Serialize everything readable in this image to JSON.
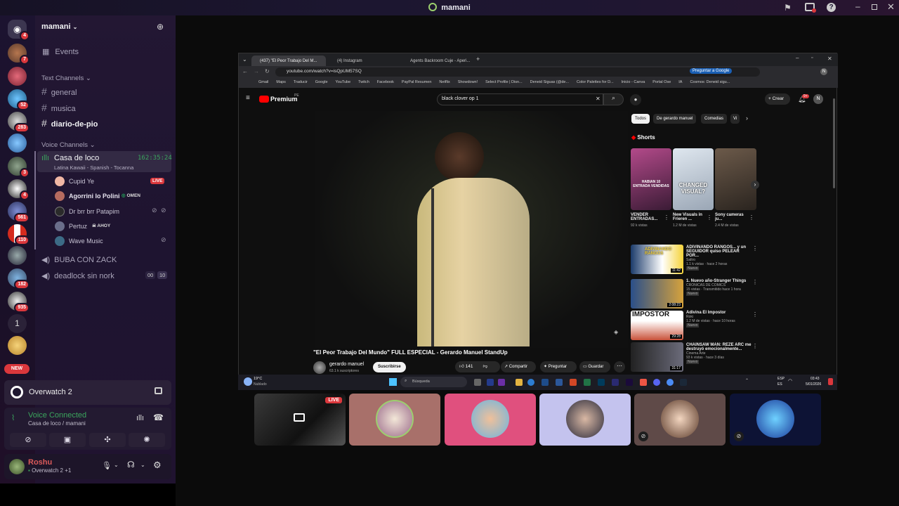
{
  "window": {
    "title": "mamani"
  },
  "servers": {
    "badges": [
      "4",
      "7",
      "52",
      "283",
      "3",
      "4",
      "561",
      "110",
      "182",
      "935"
    ],
    "one_label": "1",
    "new_label": "NEW"
  },
  "sidebar": {
    "server_name": "mamani",
    "events": "Events",
    "text_section": "Text Channels",
    "text_channels": [
      "general",
      "musica",
      "diario-de-pio"
    ],
    "voice_section": "Voice Channels",
    "active_voice": {
      "name": "Casa de loco",
      "timer": "162:35:24",
      "status": "Latina Kawaii - Spanish - Tocanna"
    },
    "voice_users": [
      {
        "name": "Cupid Ye",
        "tag": "LIVE"
      },
      {
        "name": "Agorrini lo Polini",
        "tag": "OMEN"
      },
      {
        "name": "Dr brr brr Patapim",
        "tag": ""
      },
      {
        "name": "Pertuz",
        "tag": "AHOY"
      },
      {
        "name": "Wave Music",
        "tag": ""
      }
    ],
    "other_voice": [
      {
        "name": "BUBA CON ZACK",
        "a": "",
        "b": ""
      },
      {
        "name": "deadlock sin nork",
        "a": "00",
        "b": "10"
      }
    ]
  },
  "activity": {
    "game": "Overwatch 2"
  },
  "voice_connected": {
    "title": "Voice Connected",
    "sub": "Casa de loco / mamani"
  },
  "user_panel": {
    "name": "Roshu",
    "status": "Overwatch 2 +1"
  },
  "browser": {
    "tabs": [
      "(437) \"El Peor Trabajo Del M...",
      "(4) Instagram",
      "Agents Backroom Cuje - Aperi..."
    ],
    "url": "youtube.com/watch?v=isQpUM57SQ",
    "ask_google": "Preguntar a Google",
    "bookmarks": [
      "Gmail",
      "Maps",
      "Traducir",
      "Google",
      "YouTube",
      "Twitch",
      "Facebook",
      "PayPal Resumen",
      "Netflix",
      "Showdown!",
      "Select Profile | Disn...",
      "Deneid Siguas (@de...",
      "Color Palettes for D...",
      "Inicio - Canva",
      "Portal Ose",
      "IA",
      "Cosmos: Deneid sigu..."
    ]
  },
  "youtube": {
    "logo": "Premium",
    "logo_sup": "PE",
    "search": "black clover op 1",
    "create": "Crear",
    "notif": "9+",
    "avatar": "N",
    "chips": [
      "Todos",
      "De gerardo manuel",
      "Comedias",
      "Vi"
    ],
    "shorts_title": "Shorts",
    "shorts": [
      {
        "title": "VENDER ENTRADAS...",
        "views": "92 k vistas",
        "img": "HABIAN 10 ENTRADA VENDIDAS"
      },
      {
        "title": "New Visuals in Frieren ...",
        "views": "1.2 M de vistas",
        "img": "CHANGED VISUAL?"
      },
      {
        "title": "Sony cameras ju...",
        "views": "2.4 M de vistas",
        "img": ""
      }
    ],
    "video_title": "\"El Peor Trabajo Del Mundo\" FULL ESPECIAL - Gerardo Manuel StandUp",
    "channel": "gerardo manuel",
    "subs": "63.1 k suscriptores",
    "subscribe": "Suscribirse",
    "likes": "141",
    "share": "Compartir",
    "ask": "Preguntar",
    "save": "Guardar",
    "recs": [
      {
        "title": "ADIVINANDO RANGOS... y un SEGUIDOR quiso PELEAR POR...",
        "ch": "Saltro",
        "meta": "1.1 k vistas · hace 2 horas",
        "badge": "Nuevo",
        "dur": "11:42",
        "img": "ADIVINANDO RANGOS"
      },
      {
        "title": "1. Nuevo año-Stranger Things",
        "ch": "CRONICAS DE COMICS",
        "meta": "15 vistas · Transmitido hace 1 hora",
        "badge": "Nuevo",
        "dur": "2:08:23",
        "img": ""
      },
      {
        "title": "Adivina El Impostor",
        "ch": "Roki",
        "meta": "1.2 M de vistas · hace 10 horas",
        "badge": "Nuevo",
        "dur": "29:28",
        "img": "IMPOSTOR"
      },
      {
        "title": "CHAINSAW MAN: REZE ARC me destruyó emocionalmente...",
        "ch": "Cinema Arte",
        "meta": "93 k vistas · hace 3 días",
        "badge": "Nuevo",
        "dur": "31:17",
        "img": ""
      }
    ]
  },
  "taskbar": {
    "weather": "19°C",
    "weather_sub": "Nublado",
    "search": "Búsqueda",
    "lang1": "ESP",
    "lang2": "ES",
    "time": "03:43",
    "date": "5/01/2026"
  },
  "stream_tiles": {
    "live": "LIVE"
  },
  "colors": {
    "accent": "#5865f2",
    "live": "#da373c",
    "green": "#23a55a",
    "voice_green": "#3ba55d"
  }
}
